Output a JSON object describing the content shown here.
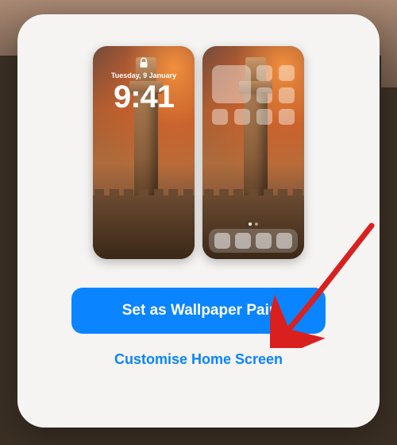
{
  "lockscreen": {
    "date": "Tuesday, 9 January",
    "time": "9:41"
  },
  "actions": {
    "primary_label": "Set as Wallpaper Pair",
    "secondary_label": "Customise Home Screen"
  },
  "colors": {
    "accent": "#0a84ff"
  },
  "icons": {
    "lock": "lock-icon"
  },
  "annotation": {
    "arrow": "arrow pointing to primary button"
  }
}
